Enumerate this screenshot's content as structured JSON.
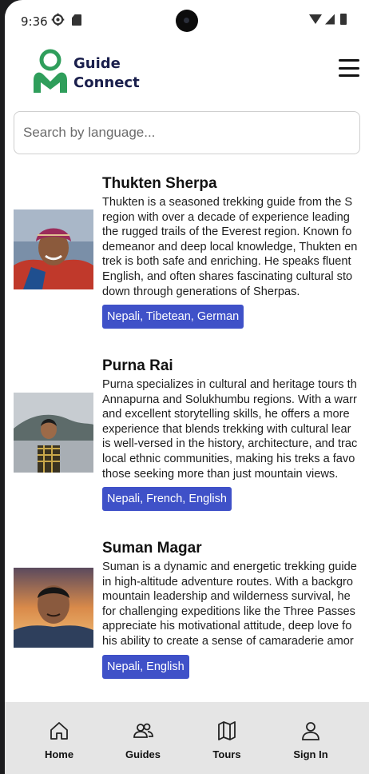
{
  "status_bar": {
    "time": "9:36"
  },
  "brand": {
    "line1": "Guide",
    "line2": "Connect"
  },
  "search": {
    "placeholder": "Search by language..."
  },
  "guides": [
    {
      "name": "Thukten Sherpa",
      "bio_lines": [
        "Thukten is a seasoned trekking guide from the S",
        "region with over a decade of experience leading",
        "the rugged trails of the Everest region. Known fo",
        "demeanor and deep local knowledge, Thukten en",
        "trek is both safe and enriching. He speaks fluent",
        "English, and often shares fascinating cultural sto",
        "down through generations of Sherpas."
      ],
      "languages": "Nepali, Tibetean, German"
    },
    {
      "name": "Purna Rai",
      "bio_lines": [
        "Purna specializes in cultural and heritage tours th",
        "Annapurna and Solukhumbu regions. With a warr",
        "and excellent storytelling skills, he offers a more",
        "experience that blends trekking with cultural lear",
        "is well-versed in the history, architecture, and trac",
        "local ethnic communities, making his treks a favo",
        "those seeking more than just mountain views."
      ],
      "languages": "Nepali, French, English"
    },
    {
      "name": "Suman Magar",
      "bio_lines": [
        "Suman is a dynamic and energetic trekking guide",
        "in high-altitude adventure routes. With a backgro",
        "mountain leadership and wilderness survival, he",
        "for challenging expeditions like the Three Passes",
        "appreciate his motivational attitude, deep love fo",
        "his ability to create a sense of camaraderie amor"
      ],
      "languages": "Nepali, English"
    }
  ],
  "nav": {
    "home": "Home",
    "guides": "Guides",
    "tours": "Tours",
    "signin": "Sign In"
  },
  "colors": {
    "brand_green": "#2f9e5b",
    "brand_navy": "#1a1f4c",
    "language_badge": "#3f51c8",
    "nav_background": "#e5e5e5"
  }
}
